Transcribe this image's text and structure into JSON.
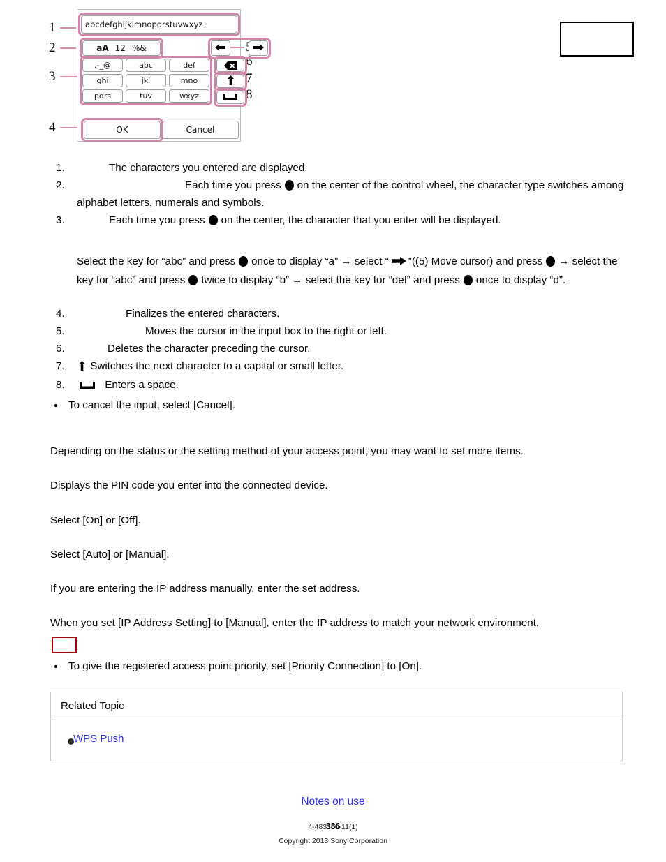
{
  "figure": {
    "callouts": [
      "1",
      "2",
      "3",
      "4",
      "5",
      "6",
      "7",
      "8"
    ],
    "input_field_value": "abcdefghijklmnopqrstuvwxyz",
    "char_type_key": {
      "alpha": "aA",
      "numeral": "12",
      "symbol": "%&"
    },
    "keys": [
      {
        "label": ".-_@"
      },
      {
        "label": "abc"
      },
      {
        "label": "def"
      },
      {
        "label": "ghi"
      },
      {
        "label": "jkl"
      },
      {
        "label": "mno"
      },
      {
        "label": "pqrs"
      },
      {
        "label": "tuv"
      },
      {
        "label": "wxyz"
      }
    ],
    "side_keys": [
      {
        "name": "arrow-left-key",
        "glyph": "←"
      },
      {
        "name": "arrow-right-key",
        "glyph": "→"
      },
      {
        "name": "backspace-key",
        "glyph": "backspace-icon"
      },
      {
        "name": "shift-key",
        "glyph": "↑"
      },
      {
        "name": "space-key",
        "glyph": "space-icon"
      }
    ],
    "ok_label": "OK",
    "cancel_label": "Cancel"
  },
  "list": {
    "item1": {
      "num": "1.",
      "text": "The characters you entered are displayed."
    },
    "item2": {
      "num": "2.",
      "text_a": "Each time you press",
      "text_b": "on the center of the control wheel, the character type switches among alphabet letters, numerals and symbols."
    },
    "item3": {
      "num": "3.",
      "text_a": "Each time you press",
      "text_b": "on the center, the character that you enter will be displayed."
    },
    "item4": {
      "num": "4.",
      "text": "Finalizes the entered characters."
    },
    "item5": {
      "num": "5.",
      "text": "Moves the cursor in the input box to the right or left."
    },
    "item6": {
      "num": "6.",
      "text": "Deletes the character preceding the cursor."
    },
    "item7": {
      "num": "7.",
      "text": "Switches the next character to a capital or small letter."
    },
    "item8": {
      "num": "8.",
      "text": "Enters a space."
    }
  },
  "example": {
    "p1": "Select the key for “abc” and press",
    "p2": "once to display “a” → select “",
    "p3": "”((5) Move cursor) and press",
    "p4": "→ select the key for “abc” and press",
    "p5": "twice to display “b” → select the key for “def” and press",
    "p6": "once to display “d”."
  },
  "cancel_note": "To cancel the input, select [Cancel].",
  "paragraphs": {
    "p_access_point": "Depending on the status or the setting method of your access point, you may want to set more items.",
    "p_pin": "Displays the PIN code you enter into the connected device.",
    "p_onoff": "Select [On] or [Off].",
    "p_automanual": "Select [Auto] or [Manual].",
    "p_ip_manual": "If you are entering the IP address manually, enter the set address.",
    "p_ip_setting": "When you set [IP Address Setting] to [Manual], enter the IP address to match your network environment."
  },
  "priority_note": "To give the registered access point priority, set [Priority Connection] to [On].",
  "related": {
    "header": "Related Topic",
    "link_label": "WPS Push"
  },
  "footer": {
    "notes_link": "Notes on use",
    "part_number": "4-483360-11(1)",
    "page_number": "336",
    "copyright": "Copyright 2013 Sony Corporation"
  },
  "colors": {
    "highlight_pink": "#d285aa",
    "link_blue": "#2a2af0",
    "red_box": "#aa0000"
  }
}
